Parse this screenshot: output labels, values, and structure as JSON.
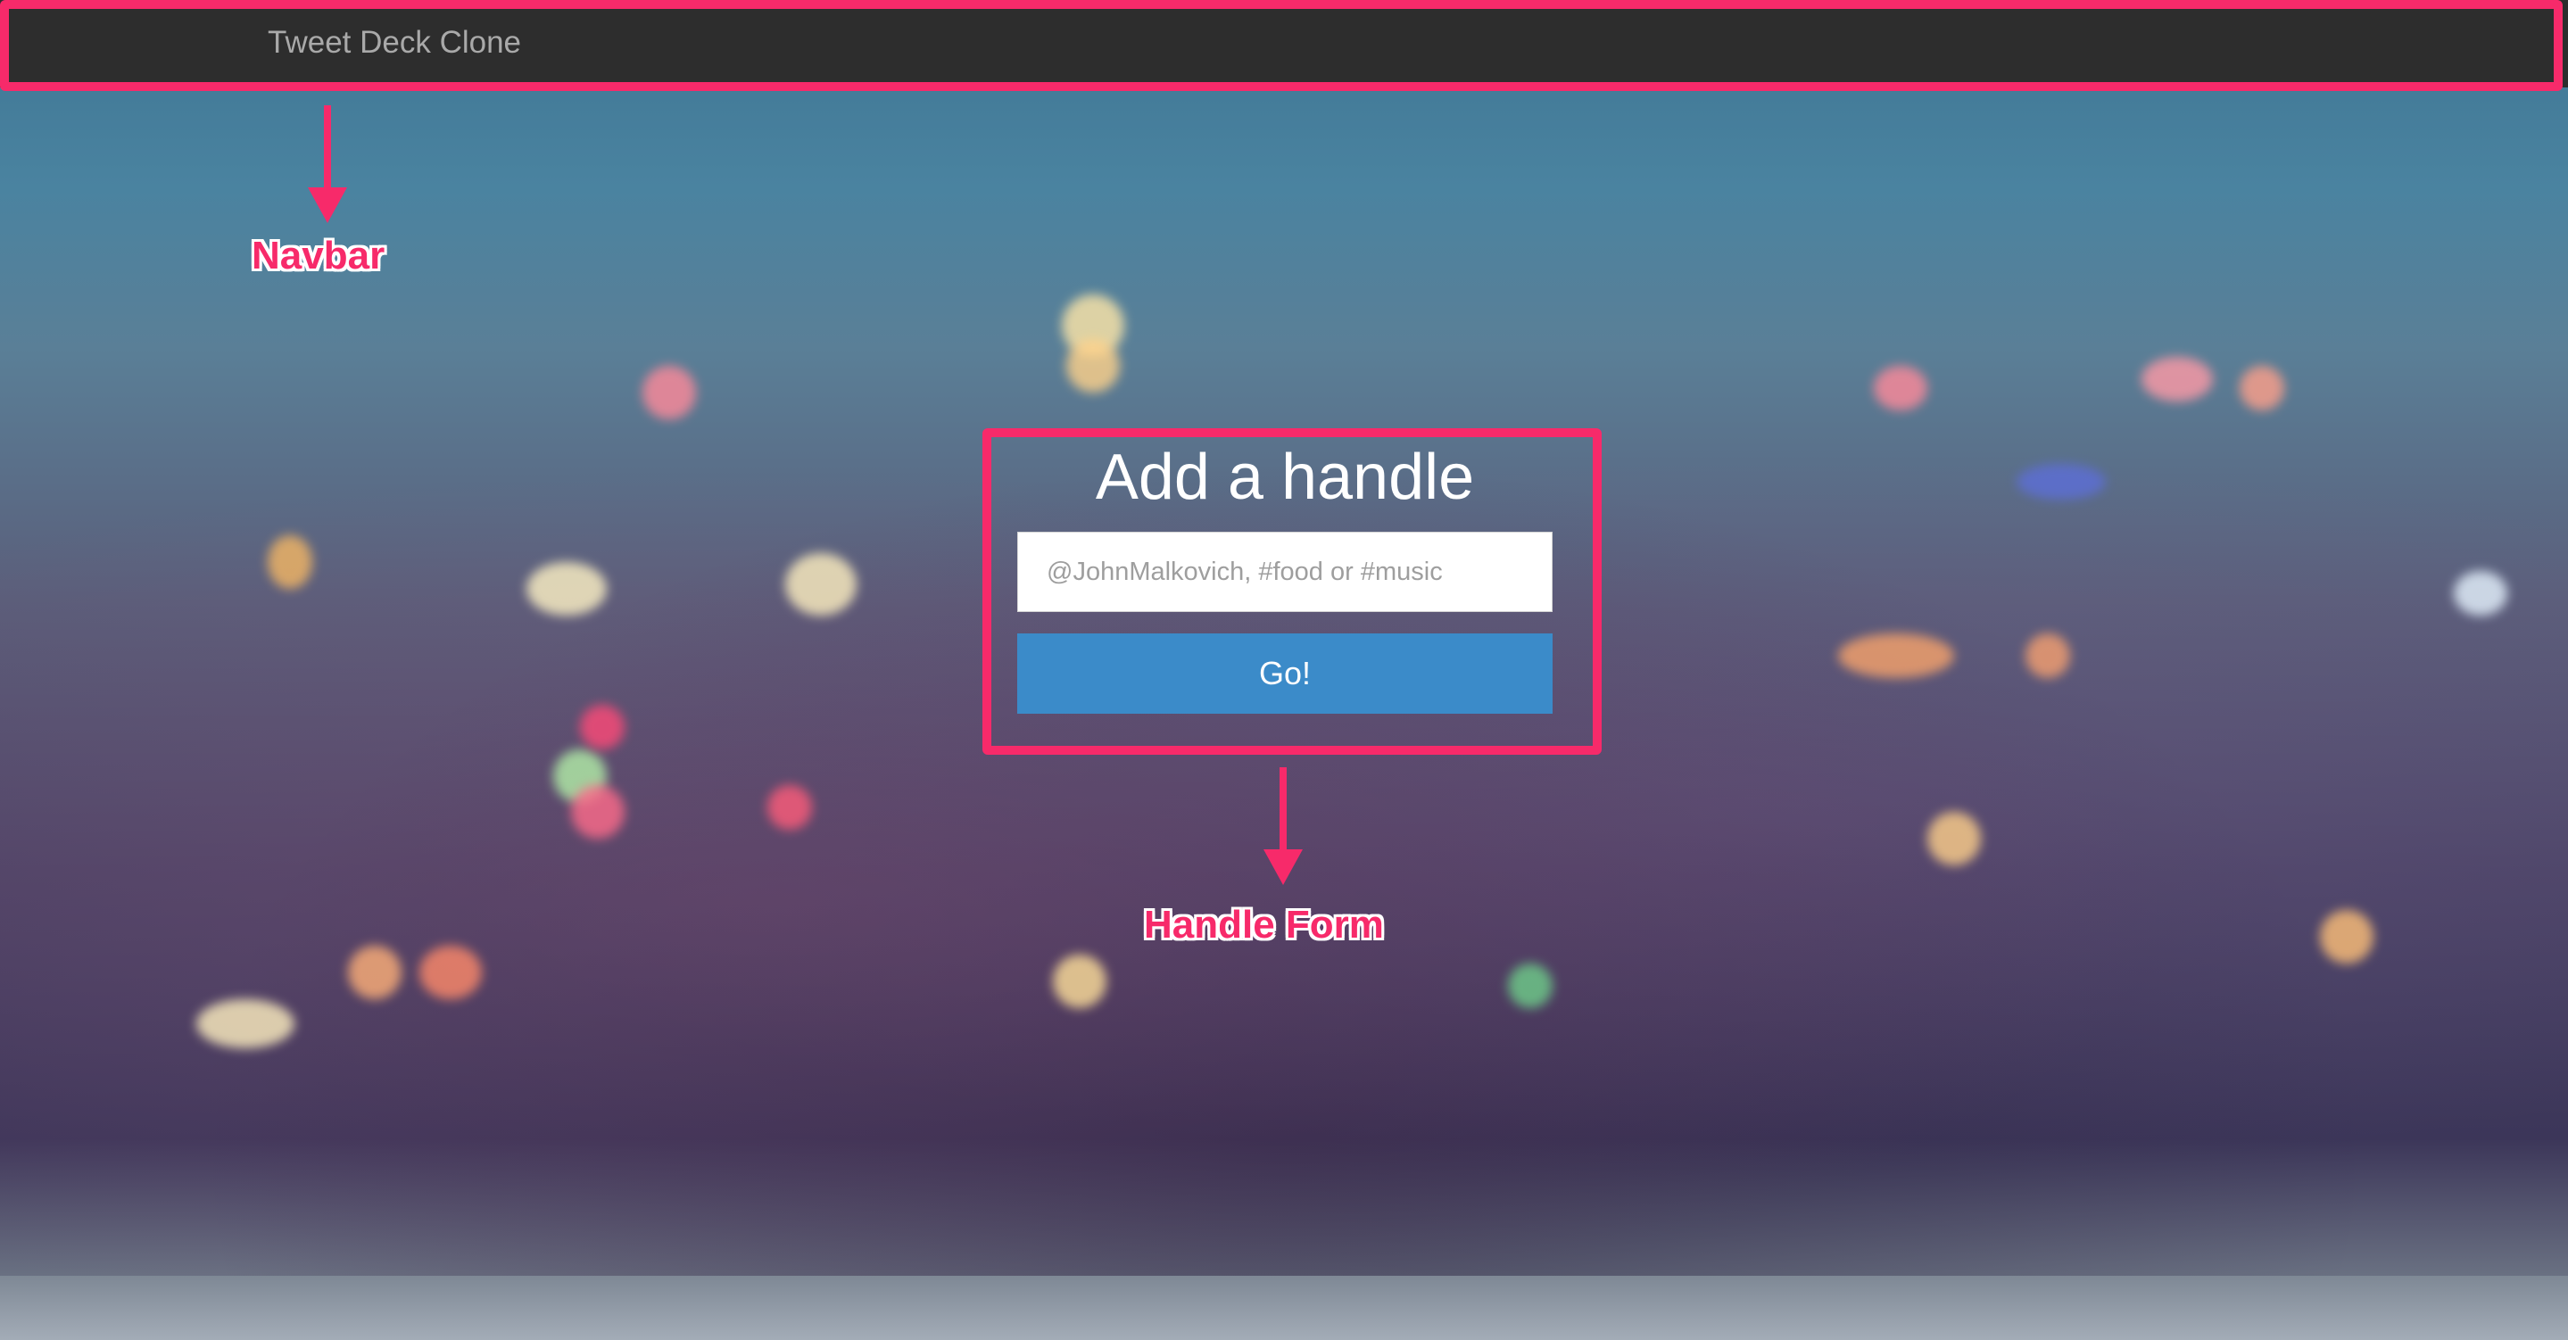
{
  "app": {
    "brand": "Tweet Deck Clone"
  },
  "form": {
    "title": "Add a handle",
    "input_value": "",
    "input_placeholder": "@JohnMalkovich, #food or #music",
    "submit_label": "Go!"
  },
  "annotations": {
    "navbar_label": "Navbar",
    "form_label": "Handle Form",
    "color": "#f72a6a"
  },
  "colors": {
    "navbar_bg": "#2d2d2d",
    "button_bg": "#3b8bc9"
  }
}
